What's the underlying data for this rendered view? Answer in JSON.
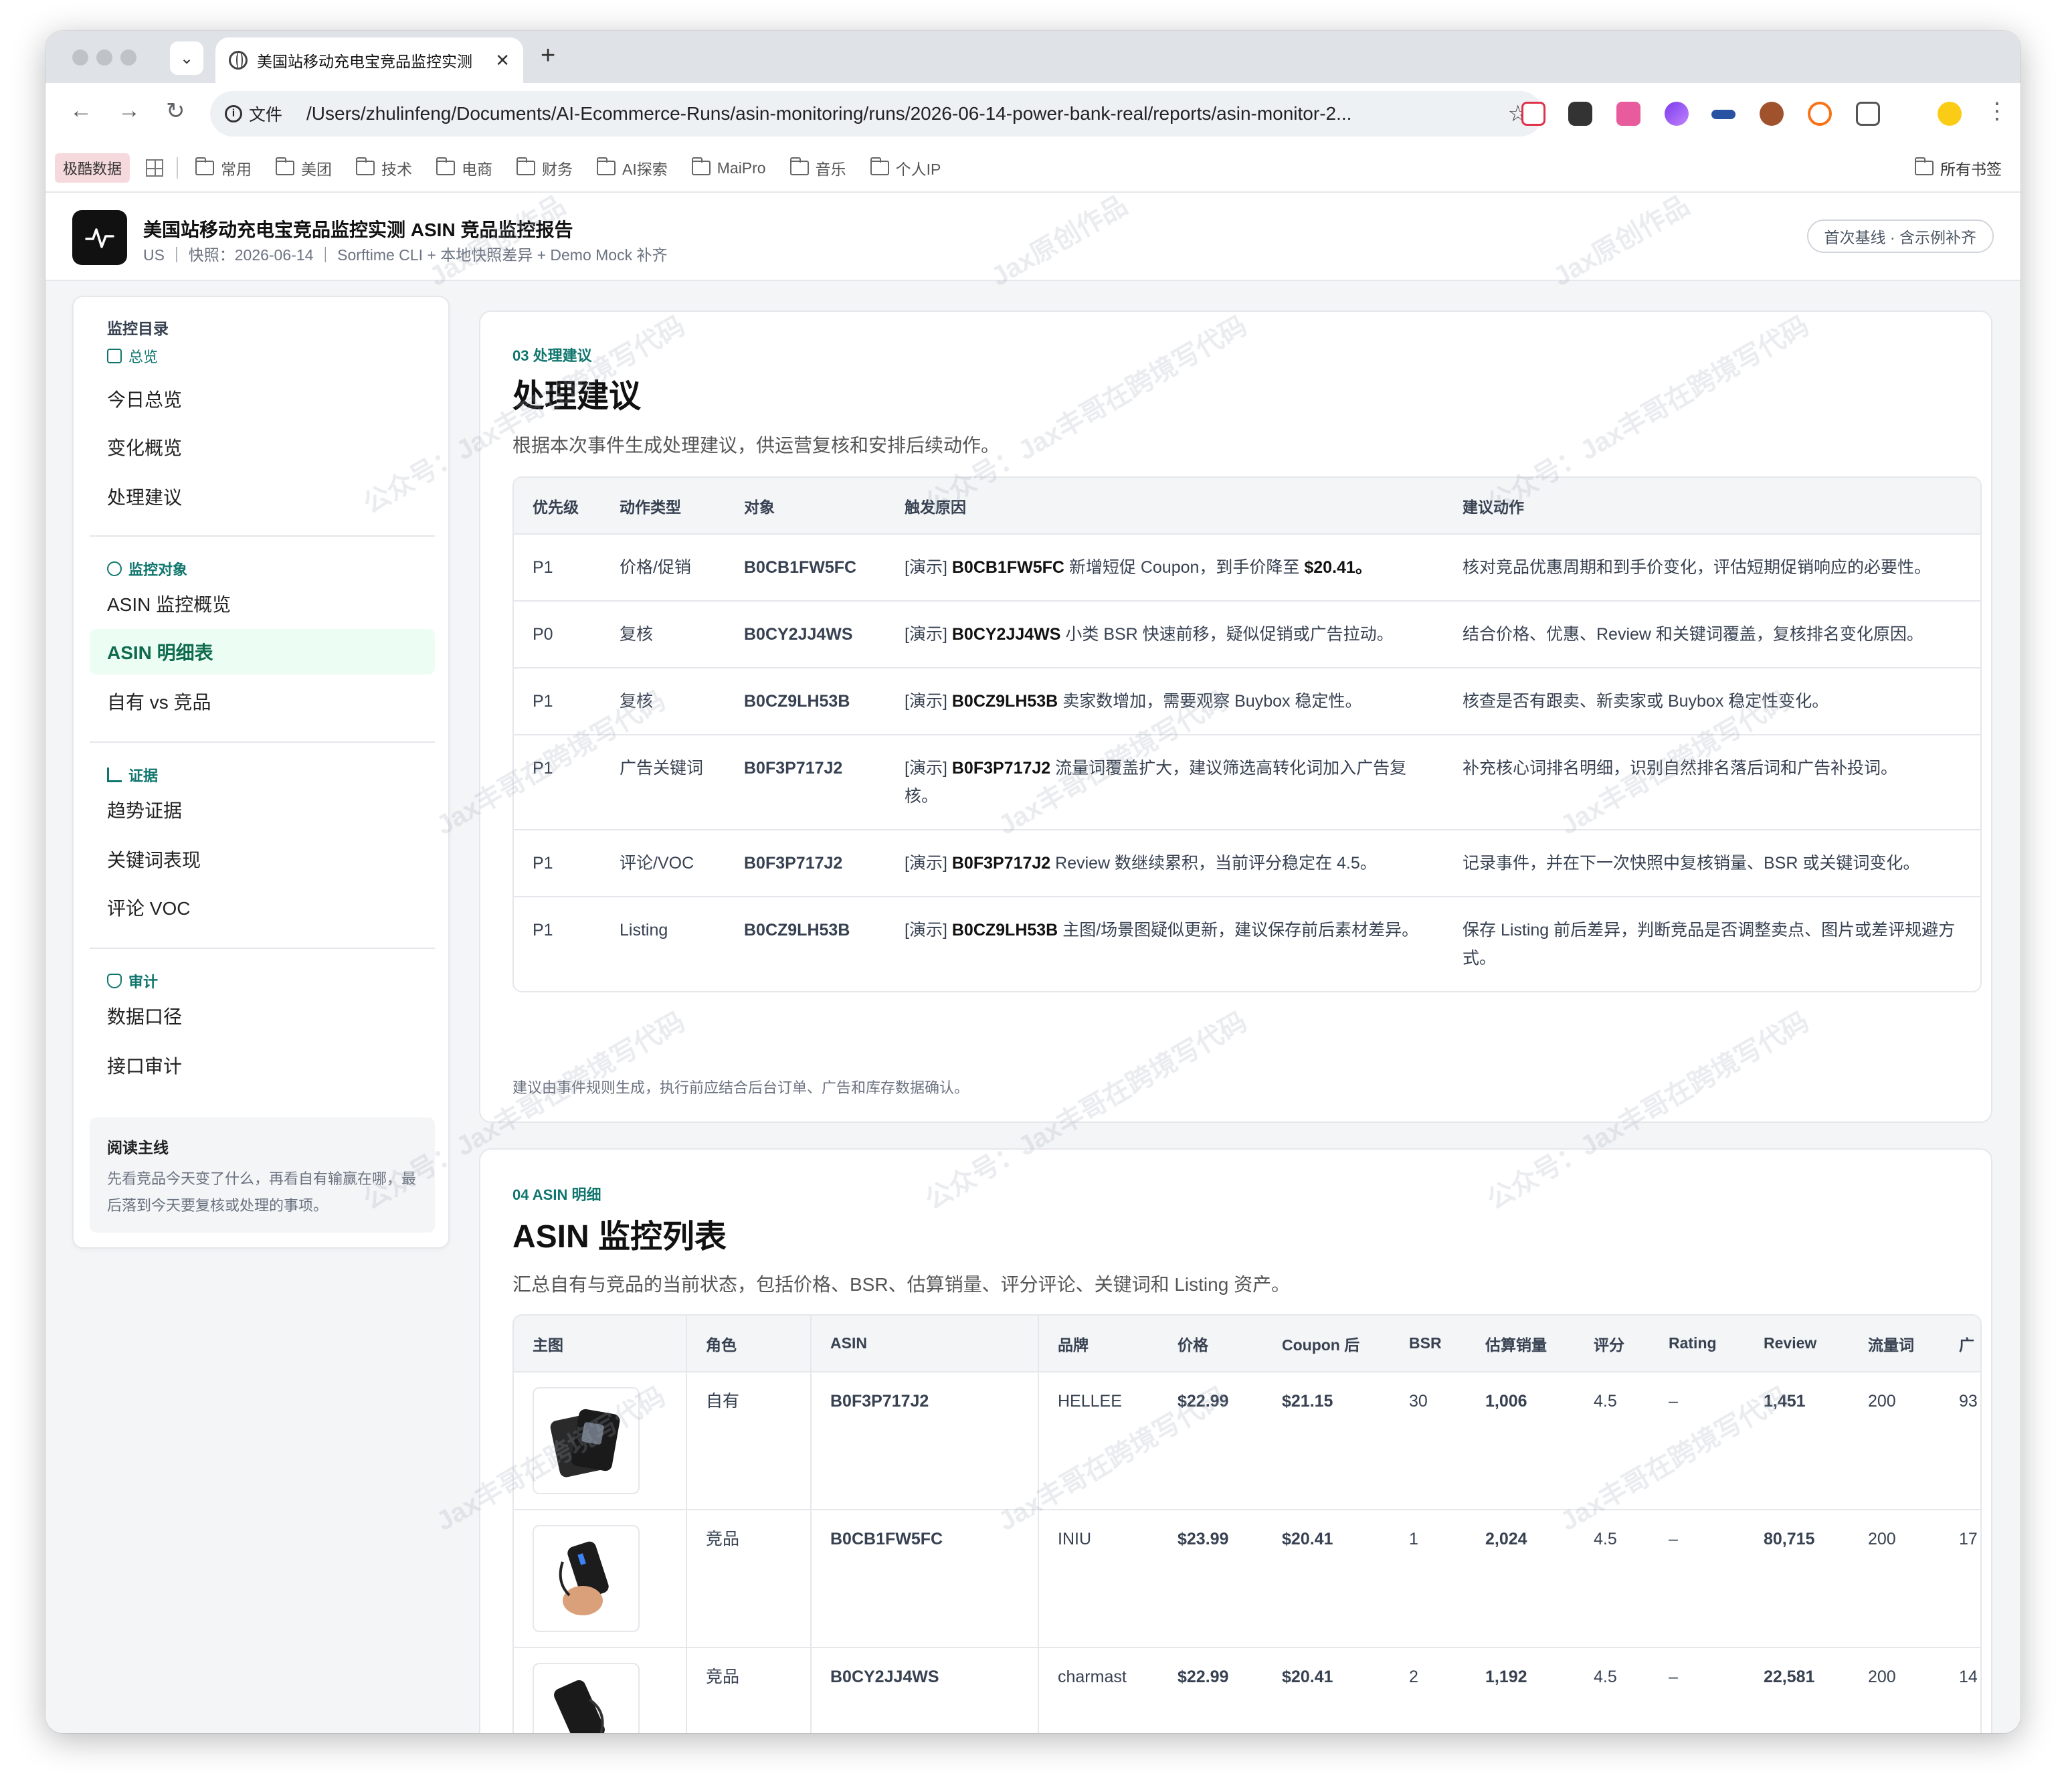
{
  "browser": {
    "tab_title": "美国站移动充电宝竞品监控实测",
    "url_scheme": "文件",
    "url": "/Users/zhulinfeng/Documents/AI-Ecommerce-Runs/asin-monitoring/runs/2026-06-14-power-bank-real/reports/asin-monitor-2...",
    "bookmarks": [
      "常用",
      "美团",
      "技术",
      "电商",
      "财务",
      "AI探索",
      "MaiPro",
      "音乐",
      "个人IP"
    ],
    "bookmark_special": "极酷数据",
    "bookmark_all": "所有书签"
  },
  "header": {
    "title": "美国站移动充电宝竞品监控实测 ASIN 竞品监控报告",
    "subtitle": "US ｜ 快照：2026-06-14 ｜ Sorftime CLI + 本地快照差异 + Demo Mock 补齐",
    "pill": "首次基线 · 含示例补齐"
  },
  "sidebar": {
    "heading": "监控目录",
    "overview_label": "总览",
    "overview_items": [
      "今日总览",
      "变化概览",
      "处理建议"
    ],
    "targets_label": "监控对象",
    "targets_items": [
      "ASIN 监控概览",
      "ASIN 明细表",
      "自有 vs 竞品"
    ],
    "evidence_label": "证据",
    "evidence_items": [
      "趋势证据",
      "关键词表现",
      "评论 VOC"
    ],
    "audit_label": "审计",
    "audit_items": [
      "数据口径",
      "接口审计"
    ],
    "note_title": "阅读主线",
    "note_text": "先看竞品今天变了什么，再看自有输赢在哪，最后落到今天要复核或处理的事项。"
  },
  "section3": {
    "eyebrow": "03 处理建议",
    "title": "处理建议",
    "desc": "根据本次事件生成处理建议，供运营复核和安排后续动作。",
    "headers": [
      "优先级",
      "动作类型",
      "对象",
      "触发原因",
      "建议动作"
    ],
    "rows": [
      {
        "priority": "P1",
        "type": "价格/促销",
        "asin": "B0CB1FW5FC",
        "reason_prefix": "[演示]",
        "reason_asin": "B0CB1FW5FC",
        "reason_text": "新增短促 Coupon，到手价降至",
        "reason_tail": "$20.41。",
        "action": "核对竞品优惠周期和到手价变化，评估短期促销响应的必要性。"
      },
      {
        "priority": "P0",
        "type": "复核",
        "asin": "B0CY2JJ4WS",
        "reason_prefix": "[演示]",
        "reason_asin": "B0CY2JJ4WS",
        "reason_text": "小类 BSR 快速前移，疑似促销或广告拉动。",
        "reason_tail": "",
        "action": "结合价格、优惠、Review 和关键词覆盖，复核排名变化原因。"
      },
      {
        "priority": "P1",
        "type": "复核",
        "asin": "B0CZ9LH53B",
        "reason_prefix": "[演示]",
        "reason_asin": "B0CZ9LH53B",
        "reason_text": "卖家数增加，需要观察 Buybox 稳定性。",
        "reason_tail": "",
        "action": "核查是否有跟卖、新卖家或 Buybox 稳定性变化。"
      },
      {
        "priority": "P1",
        "type": "广告关键词",
        "asin": "B0F3P717J2",
        "reason_prefix": "[演示]",
        "reason_asin": "B0F3P717J2",
        "reason_text": "流量词覆盖扩大，建议筛选高转化词加入广告复核。",
        "reason_tail": "",
        "action": "补充核心词排名明细，识别自然排名落后词和广告补投词。"
      },
      {
        "priority": "P1",
        "type": "评论/VOC",
        "asin": "B0F3P717J2",
        "reason_prefix": "[演示]",
        "reason_asin": "B0F3P717J2",
        "reason_text": "Review 数继续累积，当前评分稳定在 4.5。",
        "reason_tail": "",
        "action": "记录事件，并在下一次快照中复核销量、BSR 或关键词变化。"
      },
      {
        "priority": "P1",
        "type": "Listing",
        "asin": "B0CZ9LH53B",
        "reason_prefix": "[演示]",
        "reason_asin": "B0CZ9LH53B",
        "reason_text": "主图/场景图疑似更新，建议保存前后素材差异。",
        "reason_tail": "",
        "action": "保存 Listing 前后差异，判断竞品是否调整卖点、图片或差评规避方式。"
      }
    ],
    "note": "建议由事件规则生成，执行前应结合后台订单、广告和库存数据确认。"
  },
  "section4": {
    "eyebrow": "04 ASIN 明细",
    "title": "ASIN 监控列表",
    "desc": "汇总自有与竞品的当前状态，包括价格、BSR、估算销量、评分评论、关键词和 Listing 资产。",
    "headers": [
      "主图",
      "角色",
      "ASIN",
      "品牌",
      "价格",
      "Coupon 后",
      "BSR",
      "估算销量",
      "评分",
      "Rating",
      "Review",
      "流量词",
      "广"
    ],
    "rows": [
      {
        "role": "自有",
        "asin": "B0F3P717J2",
        "brand": "HELLEE",
        "price": "$22.99",
        "coupon": "$21.15",
        "bsr": "30",
        "sales": "1,006",
        "score": "4.5",
        "rating": "–",
        "review": "1,451",
        "words": "200",
        "ads": "93"
      },
      {
        "role": "竞品",
        "asin": "B0CB1FW5FC",
        "brand": "INIU",
        "price": "$23.99",
        "coupon": "$20.41",
        "bsr": "1",
        "sales": "2,024",
        "score": "4.5",
        "rating": "–",
        "review": "80,715",
        "words": "200",
        "ads": "17"
      },
      {
        "role": "竞品",
        "asin": "B0CY2JJ4WS",
        "brand": "charmast",
        "price": "$22.99",
        "coupon": "$20.41",
        "bsr": "2",
        "sales": "1,192",
        "score": "4.5",
        "rating": "–",
        "review": "22,581",
        "words": "200",
        "ads": "14"
      }
    ]
  },
  "watermark": [
    "Jax原创作品",
    "Jax丰哥在跨境写代码",
    "公众号：Jax丰哥在跨境写代码"
  ]
}
